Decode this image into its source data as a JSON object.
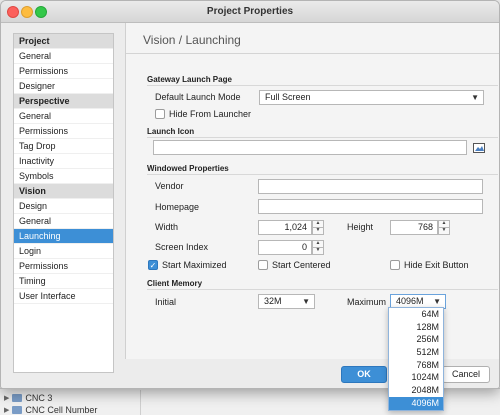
{
  "window": {
    "title": "Project Properties"
  },
  "nav": {
    "items": [
      {
        "label": "Project",
        "type": "category"
      },
      {
        "label": "General",
        "type": "item"
      },
      {
        "label": "Permissions",
        "type": "item"
      },
      {
        "label": "Designer",
        "type": "item"
      },
      {
        "label": "Perspective",
        "type": "category"
      },
      {
        "label": "General",
        "type": "item"
      },
      {
        "label": "Permissions",
        "type": "item"
      },
      {
        "label": "Tag Drop",
        "type": "item"
      },
      {
        "label": "Inactivity",
        "type": "item"
      },
      {
        "label": "Symbols",
        "type": "item"
      },
      {
        "label": "Vision",
        "type": "category"
      },
      {
        "label": "Design",
        "type": "item"
      },
      {
        "label": "General",
        "type": "item"
      },
      {
        "label": "Launching",
        "type": "item",
        "selected": true
      },
      {
        "label": "Login",
        "type": "item"
      },
      {
        "label": "Permissions",
        "type": "item"
      },
      {
        "label": "Timing",
        "type": "item"
      },
      {
        "label": "User Interface",
        "type": "item"
      }
    ]
  },
  "page": {
    "title": "Vision / Launching",
    "gateway": {
      "section": "Gateway Launch Page",
      "launch_mode_label": "Default Launch Mode",
      "launch_mode_value": "Full Screen",
      "hide_label": "Hide From Launcher",
      "hide_checked": false
    },
    "icon": {
      "section": "Launch Icon",
      "value": ""
    },
    "windowed": {
      "section": "Windowed Properties",
      "vendor_label": "Vendor",
      "vendor_value": "",
      "homepage_label": "Homepage",
      "homepage_value": "",
      "width_label": "Width",
      "width_value": "1,024",
      "height_label": "Height",
      "height_value": "768",
      "screen_index_label": "Screen Index",
      "screen_index_value": "0",
      "start_max_label": "Start Maximized",
      "start_max_checked": true,
      "start_centered_label": "Start Centered",
      "start_centered_checked": false,
      "hide_exit_label": "Hide Exit Button",
      "hide_exit_checked": false
    },
    "memory": {
      "section": "Client Memory",
      "initial_label": "Initial",
      "initial_value": "32M",
      "maximum_label": "Maximum",
      "maximum_value": "4096M",
      "maximum_options": [
        "64M",
        "128M",
        "256M",
        "512M",
        "768M",
        "1024M",
        "2048M",
        "4096M"
      ],
      "maximum_selected_index": 7
    }
  },
  "buttons": {
    "ok": "OK",
    "cancel": "Cancel"
  },
  "background": {
    "rows": [
      "CNC 3",
      "CNC Cell Number"
    ]
  },
  "colors": {
    "accent": "#3d8fd6",
    "close": "#fc605c",
    "minimize": "#fdbc40",
    "maximize": "#34c84a"
  }
}
